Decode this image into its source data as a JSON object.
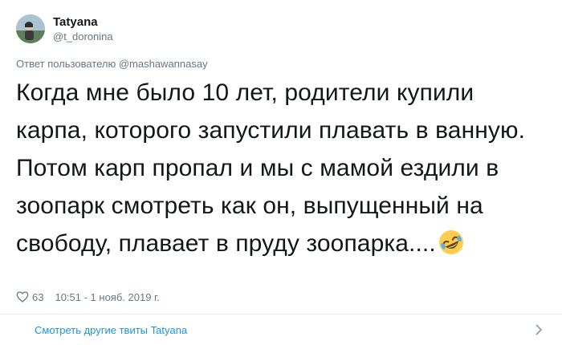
{
  "author": {
    "display_name": "Tatyana",
    "handle": "@t_doronina"
  },
  "reply": {
    "prefix": "Ответ пользователю ",
    "to_handle": "@mashawannasay"
  },
  "tweet": {
    "text": "Когда мне было 10 лет, родители купили карпа, которого запустили плавать в ванную. Потом карп пропал и мы с мамой ездили в зоопарк смотреть как он, выпущенный на свободу, плавает в пруду зоопарка....",
    "emoji": "rolling-on-the-floor-laughing-icon"
  },
  "meta": {
    "likes": "63",
    "timestamp": "10:51 - 1 нояб. 2019 г."
  },
  "footer": {
    "more_label": "Смотреть другие твиты Tatyana"
  },
  "colors": {
    "text": "#14171a",
    "secondary": "#657786",
    "link": "#1b95e0",
    "divider": "#e6ecf0"
  }
}
